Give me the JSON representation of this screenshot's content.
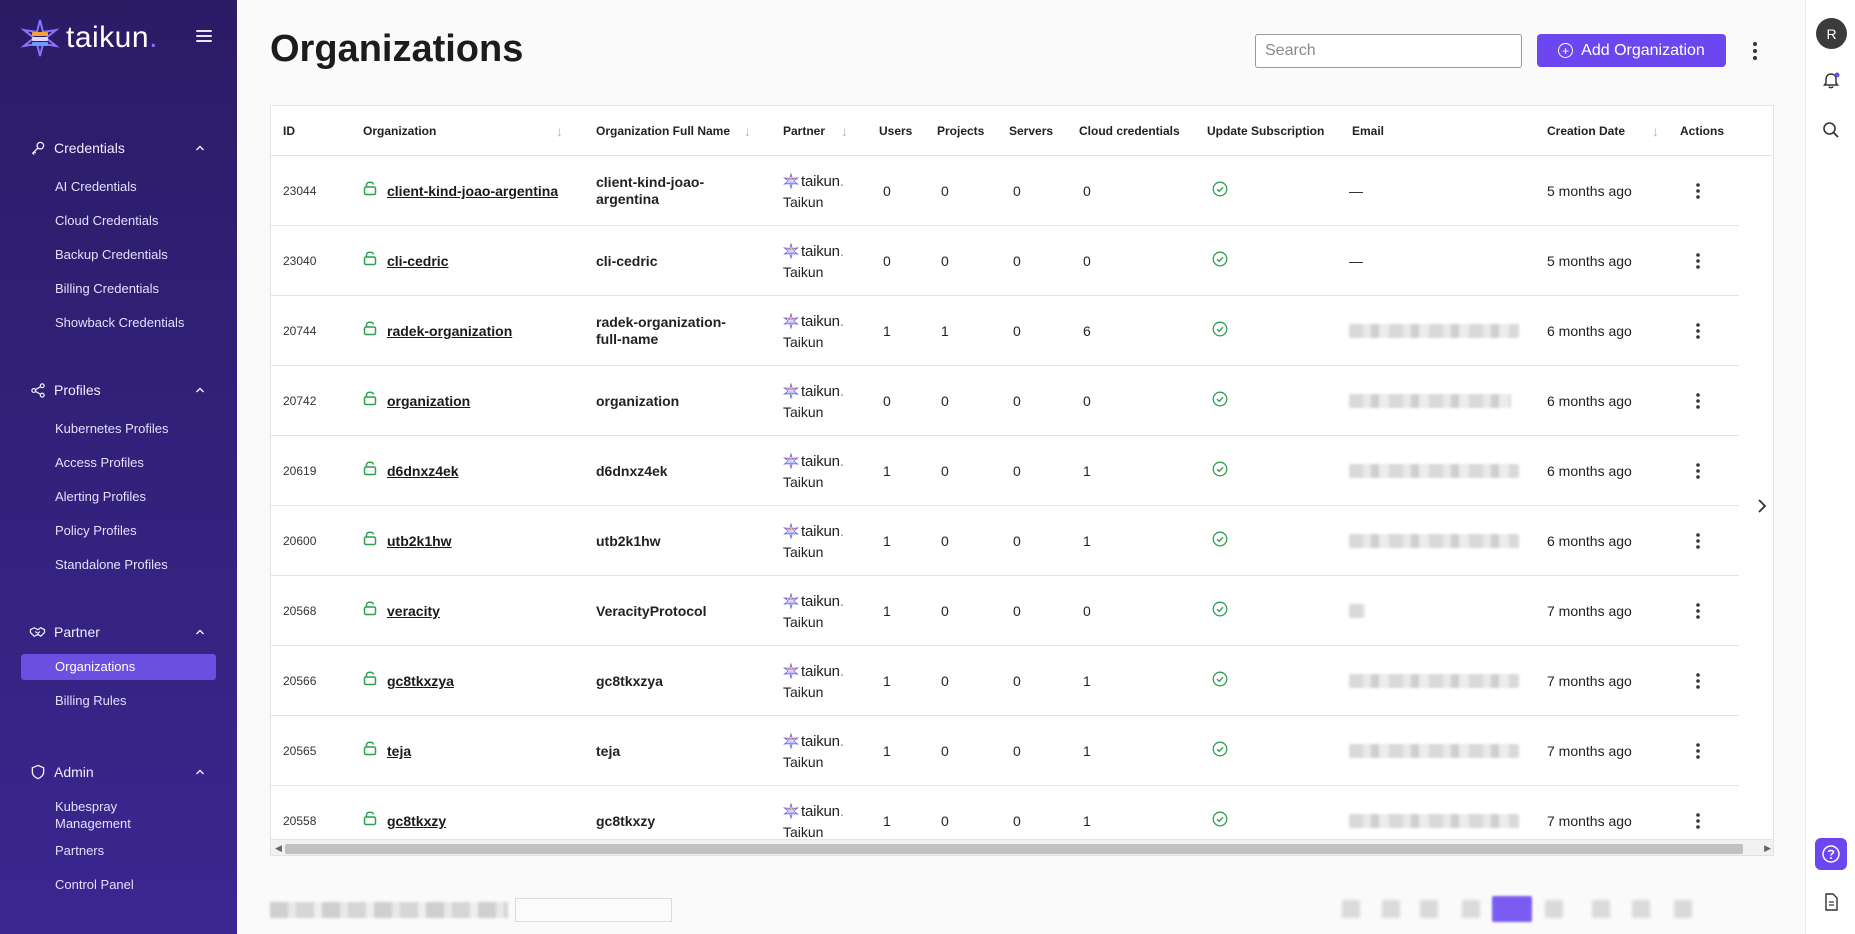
{
  "app": {
    "logo_text": "taikun",
    "logo_dot": "."
  },
  "sidebar": {
    "groups": [
      {
        "label": "Credentials",
        "icon": "key-icon",
        "items": [
          "AI Credentials",
          "Cloud Credentials",
          "Backup Credentials",
          "Billing Credentials",
          "Showback Credentials"
        ]
      },
      {
        "label": "Profiles",
        "icon": "share-nodes-icon",
        "items": [
          "Kubernetes Profiles",
          "Access Profiles",
          "Alerting Profiles",
          "Policy Profiles",
          "Standalone Profiles"
        ]
      },
      {
        "label": "Partner",
        "icon": "handshake-icon",
        "items": [
          "Organizations",
          "Billing Rules"
        ],
        "active": "Organizations"
      },
      {
        "label": "Admin",
        "icon": "shield-icon",
        "items": [
          "Kubespray Management",
          "Partners",
          "Control Panel"
        ]
      }
    ]
  },
  "header": {
    "title": "Organizations",
    "search_placeholder": "Search",
    "add_label": "Add Organization"
  },
  "table": {
    "columns": [
      "ID",
      "Organization",
      "Organization Full Name",
      "Partner",
      "Users",
      "Projects",
      "Servers",
      "Cloud credentials",
      "Update Subscription",
      "Email",
      "Creation Date",
      "Actions"
    ],
    "rows": [
      {
        "id": "23044",
        "org": "client-kind-joao-argentina",
        "full": [
          "client-kind-joao-",
          "argentina"
        ],
        "partner_logo": "taikun",
        "partner_dot": ".",
        "partner": "Taikun",
        "users": "0",
        "projects": "0",
        "servers": "0",
        "cloud": "0",
        "email": "—",
        "email_blurred": false,
        "created": "5 months ago"
      },
      {
        "id": "23040",
        "org": "cli-cedric",
        "full": [
          "cli-cedric"
        ],
        "partner_logo": "taikun",
        "partner_dot": ".",
        "partner": "Taikun",
        "users": "0",
        "projects": "0",
        "servers": "0",
        "cloud": "0",
        "email": "—",
        "email_blurred": false,
        "created": "5 months ago"
      },
      {
        "id": "20744",
        "org": "radek-organization",
        "full": [
          "radek-organization-",
          "full-name"
        ],
        "partner_logo": "taikun",
        "partner_dot": ".",
        "partner": "Taikun",
        "users": "1",
        "projects": "1",
        "servers": "0",
        "cloud": "6",
        "email": "",
        "email_blurred": true,
        "created": "6 months ago"
      },
      {
        "id": "20742",
        "org": "organization",
        "full": [
          "organization"
        ],
        "partner_logo": "taikun",
        "partner_dot": ".",
        "partner": "Taikun",
        "users": "0",
        "projects": "0",
        "servers": "0",
        "cloud": "0",
        "email": "",
        "email_blurred": true,
        "created": "6 months ago"
      },
      {
        "id": "20619",
        "org": "d6dnxz4ek",
        "full": [
          "d6dnxz4ek"
        ],
        "partner_logo": "taikun",
        "partner_dot": ".",
        "partner": "Taikun",
        "users": "1",
        "projects": "0",
        "servers": "0",
        "cloud": "1",
        "email": "",
        "email_blurred": true,
        "created": "6 months ago"
      },
      {
        "id": "20600",
        "org": "utb2k1hw",
        "full": [
          "utb2k1hw"
        ],
        "partner_logo": "taikun",
        "partner_dot": ".",
        "partner": "Taikun",
        "users": "1",
        "projects": "0",
        "servers": "0",
        "cloud": "1",
        "email": "",
        "email_blurred": true,
        "created": "6 months ago"
      },
      {
        "id": "20568",
        "org": "veracity",
        "full": [
          "VeracityProtocol"
        ],
        "partner_logo": "taikun",
        "partner_dot": ".",
        "partner": "Taikun",
        "users": "1",
        "projects": "0",
        "servers": "0",
        "cloud": "0",
        "email": "",
        "email_blurred": true,
        "email_short": true,
        "created": "7 months ago"
      },
      {
        "id": "20566",
        "org": "gc8tkxzya",
        "full": [
          "gc8tkxzya"
        ],
        "partner_logo": "taikun",
        "partner_dot": ".",
        "partner": "Taikun",
        "users": "1",
        "projects": "0",
        "servers": "0",
        "cloud": "1",
        "email": "",
        "email_blurred": true,
        "created": "7 months ago"
      },
      {
        "id": "20565",
        "org": "teja",
        "full": [
          "teja"
        ],
        "partner_logo": "taikun",
        "partner_dot": ".",
        "partner": "Taikun",
        "users": "1",
        "projects": "0",
        "servers": "0",
        "cloud": "1",
        "email": "",
        "email_blurred": true,
        "created": "7 months ago"
      },
      {
        "id": "20558",
        "org": "gc8tkxzy",
        "full": [
          "gc8tkxzy"
        ],
        "partner_logo": "taikun",
        "partner_dot": ".",
        "partner": "Taikun",
        "users": "1",
        "projects": "0",
        "servers": "0",
        "cloud": "1",
        "email": "",
        "email_blurred": true,
        "created": "7 months ago"
      }
    ]
  },
  "rail": {
    "avatar_initial": "R"
  },
  "colors": {
    "accent": "#6c47f0",
    "sidebar_top": "#2b1c66",
    "sidebar_bottom": "#3a2790",
    "active_item": "#6a4fe0",
    "check_green": "#2e9e4f"
  }
}
